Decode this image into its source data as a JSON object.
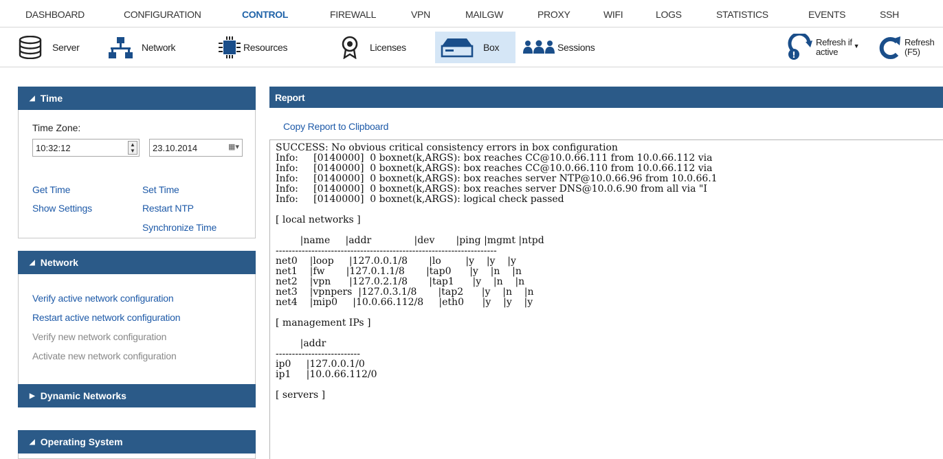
{
  "nav": {
    "items": [
      "DASHBOARD",
      "CONFIGURATION",
      "CONTROL",
      "FIREWALL",
      "VPN",
      "MAILGW",
      "PROXY",
      "WIFI",
      "LOGS",
      "STATISTICS",
      "EVENTS",
      "SSH"
    ],
    "active": "CONTROL"
  },
  "toolbar": {
    "server": "Server",
    "network": "Network",
    "resources": "Resources",
    "licenses": "Licenses",
    "box": "Box",
    "sessions": "Sessions",
    "refresh_if_active": "Refresh if\nactive",
    "refresh_f5": "Refresh\n(F5)",
    "active_item": "Box"
  },
  "time_panel": {
    "title": "Time",
    "timezone_label": "Time Zone:",
    "time_value": "10:32:12",
    "date_value": "23.10.2014",
    "get_time": "Get Time",
    "set_time": "Set Time",
    "show_settings": "Show Settings",
    "restart_ntp": "Restart NTP",
    "synchronize_time": "Synchronize Time"
  },
  "network_panel": {
    "title": "Network",
    "verify_active": "Verify active network configuration",
    "restart_active": "Restart active network configuration",
    "verify_new": "Verify new network configuration",
    "activate_new": "Activate new network configuration"
  },
  "dynamic_networks_panel": {
    "title": "Dynamic Networks"
  },
  "operating_system_panel": {
    "title": "Operating System"
  },
  "report": {
    "title": "Report",
    "copy_link": "Copy Report to Clipboard",
    "text": "SUCCESS: No obvious critical consistency errors in box configuration\nInfo:     [0140000]  0 boxnet(k,ARGS): box reaches CC@10.0.66.111 from 10.0.66.112 via\nInfo:     [0140000]  0 boxnet(k,ARGS): box reaches CC@10.0.66.110 from 10.0.66.112 via\nInfo:     [0140000]  0 boxnet(k,ARGS): box reaches server NTP@10.0.66.96 from 10.0.66.1\nInfo:     [0140000]  0 boxnet(k,ARGS): box reaches server DNS@10.0.6.90 from all via \"I\nInfo:     [0140000]  0 boxnet(k,ARGS): logical check passed\n\n[ local networks ]\n\n        |name     |addr              |dev       |ping |mgmt |ntpd\n--------------------------------------------------------------------\nnet0    |loop     |127.0.0.1/8       |lo        |y    |y    |y\nnet1    |fw       |127.0.1.1/8       |tap0      |y    |n    |n\nnet2    |vpn      |127.0.2.1/8       |tap1      |y    |n    |n\nnet3    |vpnpers  |127.0.3.1/8       |tap2      |y    |n    |n\nnet4    |mip0     |10.0.66.112/8     |eth0      |y    |y    |y\n\n[ management IPs ]\n\n        |addr\n--------------------------\nip0     |127.0.0.1/0\nip1     |10.0.66.112/0\n\n[ servers ]"
  },
  "colors": {
    "panel_header": "#2b5a88",
    "link": "#1e5aa8",
    "active_nav": "#1e62a8",
    "active_toolbar_bg": "#d5e6f6"
  }
}
